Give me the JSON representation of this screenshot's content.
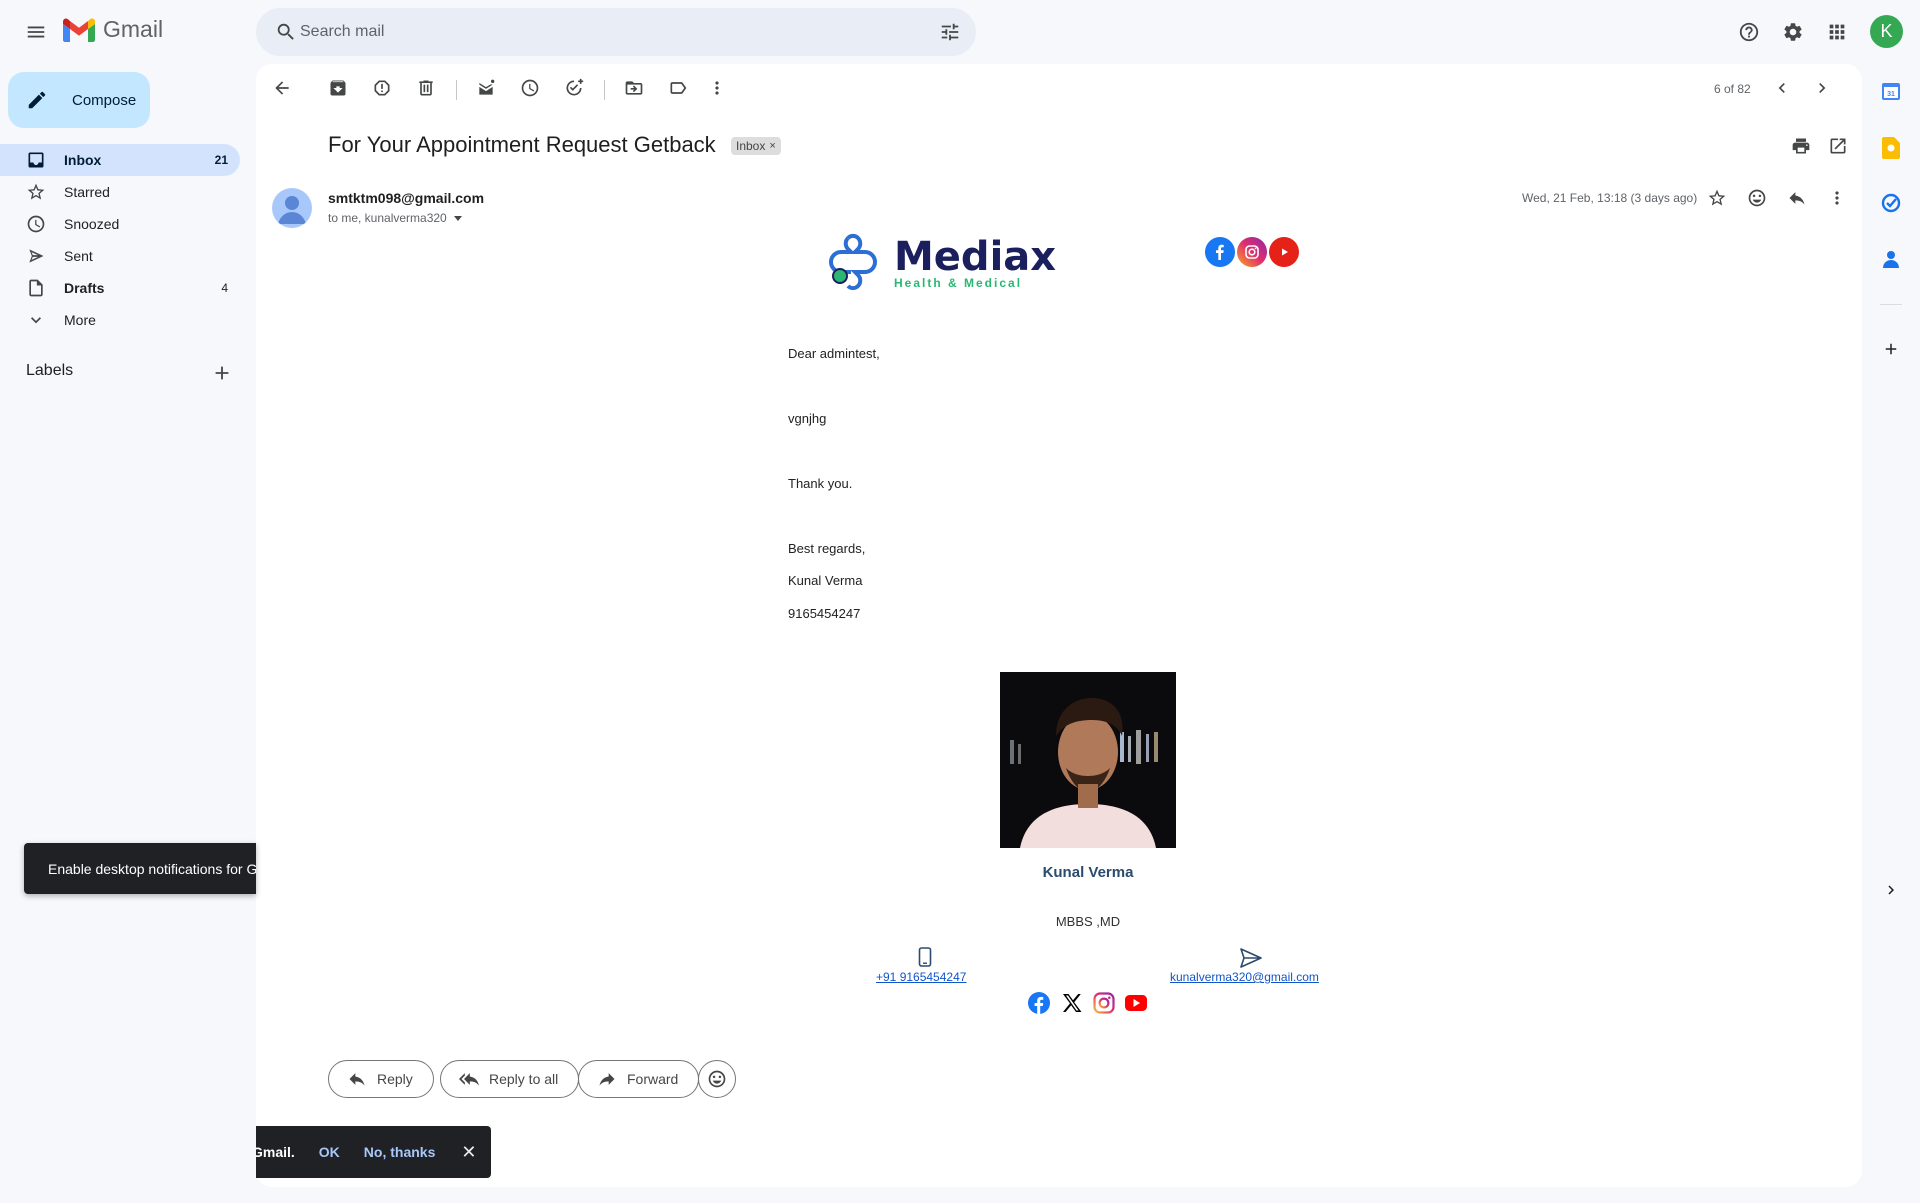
{
  "app": {
    "name": "Gmail",
    "avatar_letter": "K"
  },
  "search": {
    "placeholder": "Search mail"
  },
  "sidebar": {
    "compose_label": "Compose",
    "items": [
      {
        "label": "Inbox",
        "count": "21"
      },
      {
        "label": "Starred",
        "count": ""
      },
      {
        "label": "Snoozed",
        "count": ""
      },
      {
        "label": "Sent",
        "count": ""
      },
      {
        "label": "Drafts",
        "count": "4"
      },
      {
        "label": "More",
        "count": ""
      }
    ],
    "labels_title": "Labels"
  },
  "toolbar": {
    "pager": "6 of 82"
  },
  "message": {
    "subject": "For Your Appointment Request Getback",
    "label_chip": "Inbox",
    "sender": "smtktm098@gmail.com",
    "recipients": "to me, kunalverma320",
    "date": "Wed, 21 Feb, 13:18 (3 days ago)"
  },
  "email_body": {
    "brand_name": "Mediax",
    "brand_tagline": "Health & Medical",
    "greeting": "Dear admintest,",
    "content": "vgnjhg",
    "thanks": "Thank you.",
    "closing": "Best regards,",
    "name": "Kunal Verma",
    "phone": "9165454247",
    "signature": {
      "name": "Kunal Verma",
      "title": "MBBS ,MD",
      "phone_link": "+91 9165454247",
      "email_link": "kunalverma320@gmail.com"
    }
  },
  "actions": {
    "reply": "Reply",
    "reply_all": "Reply to all",
    "forward": "Forward"
  },
  "toasts": {
    "desktop_notifications": "Enable desktop notifications for Gmail.",
    "tail": "Gmail.",
    "ok": "OK",
    "no_thanks": "No, thanks"
  },
  "colors": {
    "facebook": "#1877f2",
    "instagram": "#e1306c",
    "youtube": "#ff0000",
    "compose_bg": "#c2e7ff",
    "inbox_active_bg": "#d3e3fd",
    "avatar_bg": "#34a853"
  }
}
